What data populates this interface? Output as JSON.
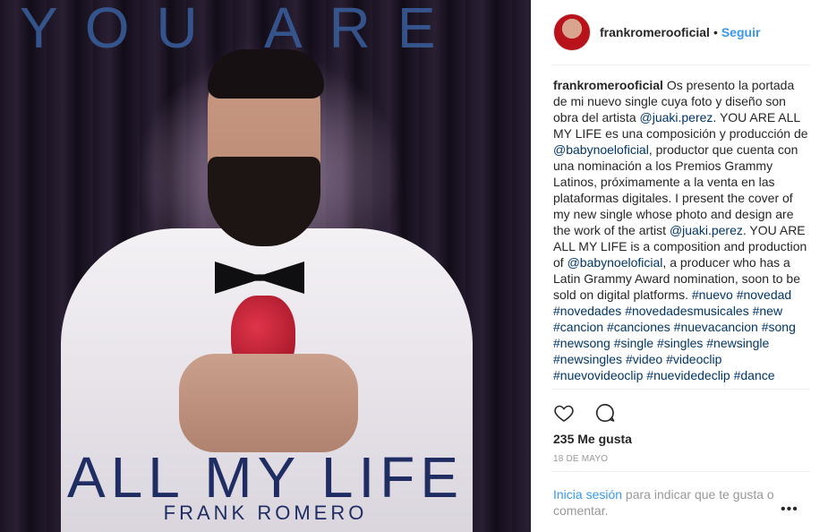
{
  "media": {
    "top_text": "YOU ARE",
    "bottom_text": "ALL MY LIFE",
    "artist_text": "FRANK ROMERO"
  },
  "header": {
    "username": "frankromerooficial",
    "separator": "•",
    "follow_label": "Seguir"
  },
  "caption": {
    "username": "frankromerooficial",
    "text_1": " Os presento la portada de mi nuevo single cuya foto y diseño son obra del artista ",
    "mention_1": "@juaki.perez",
    "text_2": ". YOU ARE ALL MY LIFE es una composición y producción de ",
    "mention_2": "@babynoeloficial",
    "text_3": ", productor que cuenta con una nominación a los Premios Grammy Latinos, próximamente a la venta en las plataformas digitales. I present the cover of my new single whose photo and design are the work of the artist ",
    "mention_3": "@juaki.perez",
    "text_4": ". YOU ARE ALL MY LIFE is a composition and production of ",
    "mention_4": "@babynoeloficial",
    "text_5": ", a producer who has a Latin Grammy Award nomination, soon to be sold on digital platforms. ",
    "hashtags": [
      "#nuevo",
      "#novedad",
      "#novedades",
      "#novedadesmusicales",
      "#new",
      "#cancion",
      "#canciones",
      "#nuevacancion",
      "#song",
      "#newsong",
      "#single",
      "#singles",
      "#newsingle",
      "#newsingles",
      "#video",
      "#videoclip",
      "#nuevovideoclip",
      "#nuevidedeclip",
      "#dance"
    ]
  },
  "actions": {
    "like_icon": "heart-icon",
    "comment_icon": "comment-icon"
  },
  "likes": "235 Me gusta",
  "date": "18 DE MAYO",
  "login": {
    "link": "Inicia sesión",
    "text": " para indicar que te gusta o comentar."
  },
  "more_label": "•••"
}
